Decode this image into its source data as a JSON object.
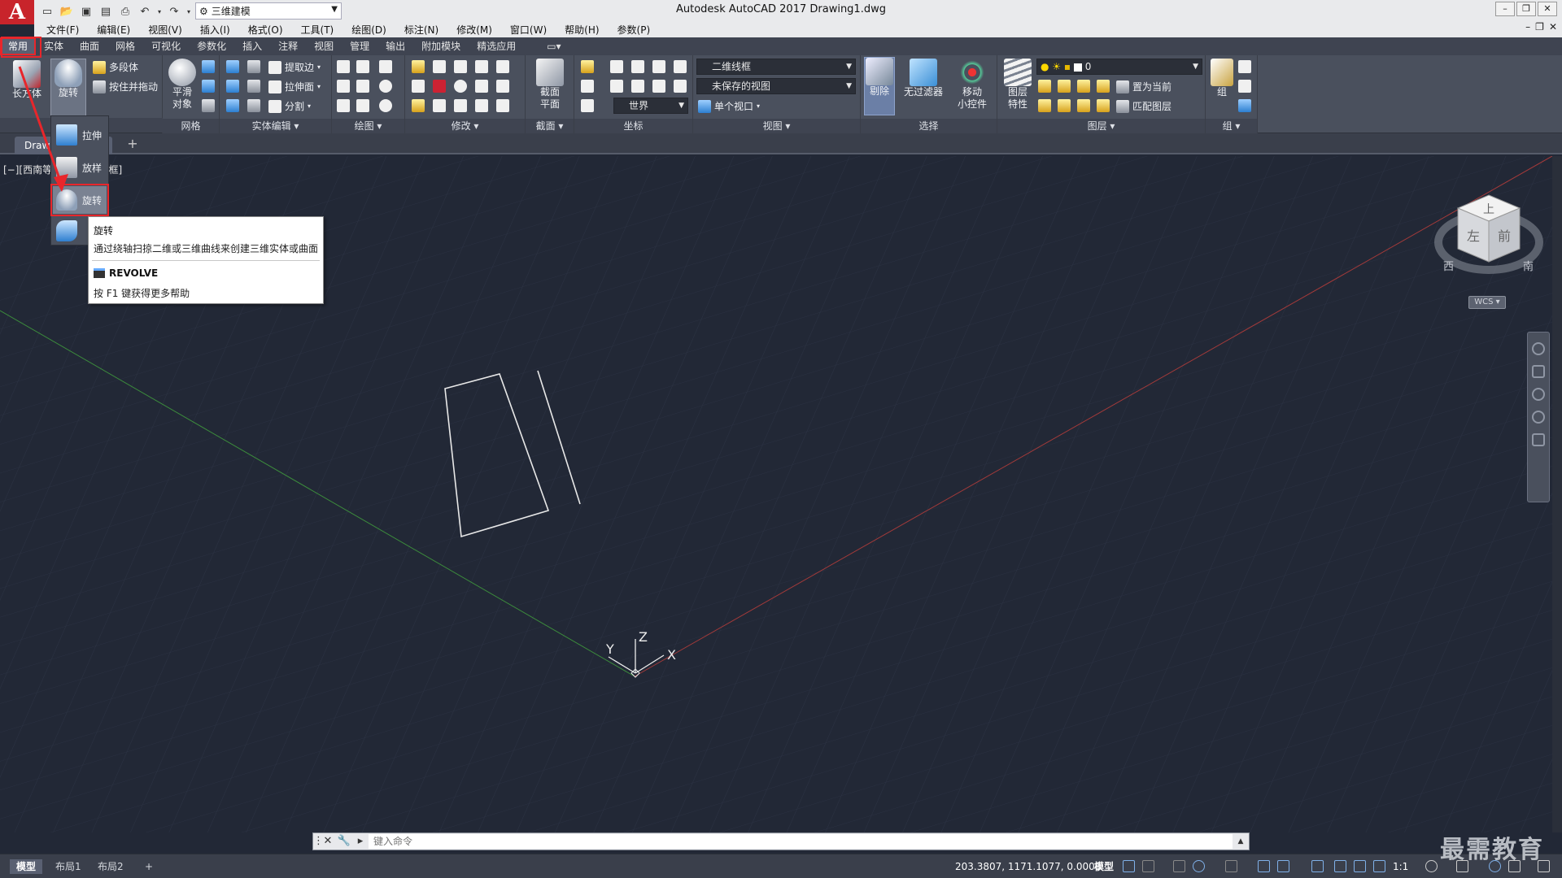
{
  "app": {
    "logo_letter": "A",
    "window_title": "Autodesk AutoCAD 2017    Drawing1.dwg",
    "workspace": "三维建模"
  },
  "menu": [
    "文件(F)",
    "编辑(E)",
    "视图(V)",
    "插入(I)",
    "格式(O)",
    "工具(T)",
    "绘图(D)",
    "标注(N)",
    "修改(M)",
    "窗口(W)",
    "帮助(H)",
    "参数(P)"
  ],
  "ribbon_tabs": [
    "常用",
    "实体",
    "曲面",
    "网格",
    "可视化",
    "参数化",
    "插入",
    "注释",
    "视图",
    "管理",
    "输出",
    "附加模块",
    "精选应用"
  ],
  "ribbon": {
    "box_label": "长方体",
    "revolve_label": "旋转",
    "polysolid_label": "多段体",
    "presspull_label": "按住并拖动",
    "smooth_label": "平滑\n对象",
    "mesh_panel": "网格",
    "extract_edges": "提取边",
    "extrude_faces": "拉伸面",
    "separate": "分割",
    "solid_edit_panel": "实体编辑",
    "draw_panel": "绘图",
    "modify_panel": "修改",
    "section_plane": "截面\n平面",
    "section_panel": "截面",
    "ucs_world": "世界",
    "coordinates_panel": "坐标",
    "visual_style": "二维线框",
    "saved_view": "未保存的视图",
    "single_viewport": "单个视口",
    "view_panel": "视图",
    "culling": "剔除",
    "no_filter": "无过滤器",
    "move_gizmo": "移动\n小控件",
    "selection_panel": "选择",
    "layer_properties": "图层\n特性",
    "layer_current_value": "0",
    "make_current": "置为当前",
    "match_layer": "匹配图层",
    "layers_panel": "图层",
    "group_label": "组",
    "groups_panel": "组"
  },
  "file_tab": "Drawing1*",
  "viewport_label": "[−][西南等轴测][二维线框]",
  "flyout": [
    "拉伸",
    "放样",
    "旋转",
    "扫掠"
  ],
  "tooltip": {
    "title": "旋转",
    "description": "通过绕轴扫掠二维或三维曲线来创建三维实体或曲面",
    "command": "REVOLVE",
    "help": "按 F1 键获得更多帮助"
  },
  "ucs_axes": {
    "x": "X",
    "y": "Y",
    "z": "Z"
  },
  "viewcube": {
    "top": "上",
    "left": "左",
    "front": "前",
    "west": "西",
    "south": "南",
    "wcs": "WCS"
  },
  "command_line": {
    "placeholder": "键入命令"
  },
  "status": {
    "layouts": [
      "模型",
      "布局1",
      "布局2"
    ],
    "coordinates": "203.3807, 1171.1077, 0.0000",
    "model": "模型",
    "scale": "1:1"
  },
  "watermark": "最需教育",
  "colors": {
    "highlight": "#e8262b",
    "background": "#222836",
    "x_axis": "#a33a3a",
    "y_axis": "#3c8c3c"
  }
}
